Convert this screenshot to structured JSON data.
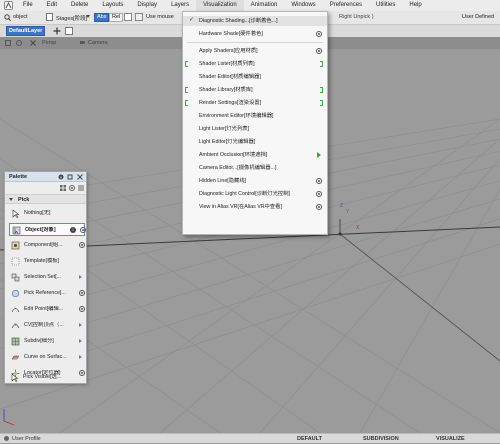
{
  "menubar": {
    "items": [
      "File",
      "Edit",
      "Delete",
      "Layouts",
      "Display",
      "Layers",
      "Visualization",
      "Animation",
      "Windows",
      "Preferences",
      "Utilities",
      "Help"
    ]
  },
  "toolbar": {
    "object_label": "object",
    "stages_label": "Stages[阶段]",
    "abs_label": "Abs",
    "rel_label": "Rel",
    "use_mouse_label": "Use mouse",
    "right_unpick_label": "Right Unpick )",
    "user_defined_label": "User Defined",
    "layer_label": "DefaultLayer"
  },
  "viewport_bar": {
    "persp_label": "Persp",
    "camera_label": "Camera"
  },
  "visualization_menu": {
    "items": [
      {
        "label": "Diagnostic Shading...[诊断着色...]",
        "checked": true
      },
      {
        "label": "Hardware Shade[硬件着色]",
        "option": true
      },
      {
        "label": "Apply Shaders[应用材质]",
        "option": true
      },
      {
        "label": "Shader Lister[材质列表]",
        "bracketed": true
      },
      {
        "label": "Shader Editor[材质编辑器]"
      },
      {
        "label": "Shader Library[材质库]",
        "bracketed": true
      },
      {
        "label": "Render Settings[渲染设置]",
        "bracketed": true
      },
      {
        "label": "Environment Editor[环境编辑器]"
      },
      {
        "label": "Light Lister[灯光列表]"
      },
      {
        "label": "Light Editor[灯光编辑器]"
      },
      {
        "label": "Ambient Occlusion[环境遮挡]",
        "submenu": true
      },
      {
        "label": "Camera Editor...[摄像机编辑器...]"
      },
      {
        "label": "Hidden Line[隐藏线]",
        "option": true
      },
      {
        "label": "Diagnostic Light Control[诊断灯光控制]",
        "option": true
      },
      {
        "label": "View in Alias VR[在Alias VR中查看]",
        "option": true
      }
    ]
  },
  "palette": {
    "title": "Palette",
    "section": "Pick",
    "items": [
      {
        "label": "Nothing[无]"
      },
      {
        "label": "Object[对象]",
        "selected": true,
        "info": true,
        "option": true
      },
      {
        "label": "Component[组...",
        "option": true
      },
      {
        "label": "Template[模板]"
      },
      {
        "label": "Selection Set[...",
        "submenu": true
      },
      {
        "label": "Pick Reference[...",
        "option": true
      },
      {
        "label": "Edit Point[编辑...",
        "option": true
      },
      {
        "label": "CV[控制顶点（...",
        "submenu": true
      },
      {
        "label": "Subdiv[细分]",
        "submenu": true
      },
      {
        "label": "Curve on Surfac...",
        "submenu": true
      },
      {
        "label": "Locator[定位器]",
        "option": true
      },
      {
        "label": "Pick Visible[选..."
      }
    ]
  },
  "axis": {
    "x": "X",
    "y": "Y",
    "z": "Z"
  },
  "statusbar": {
    "user_profile": "User Profile",
    "tabs": [
      "DEFAULT",
      "SUBDIVISION",
      "VISUALIZE"
    ]
  },
  "colors": {
    "accent_green": "#3aa04a",
    "pick_blue": "#5a7fc7",
    "layer_blue": "#3d73c4"
  }
}
